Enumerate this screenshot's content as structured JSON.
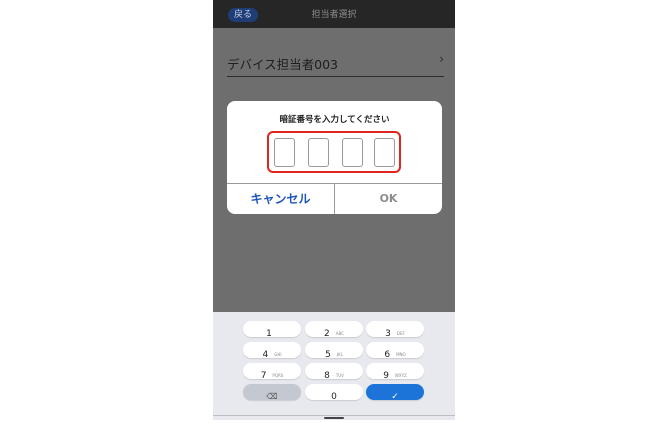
{
  "header": {
    "back_label": "戻る",
    "title": "担当者選択"
  },
  "list": {
    "item_label": "デバイス担当者003",
    "chevron": "›"
  },
  "dialog": {
    "title": "暗証番号を入力してください",
    "pin_digits": [
      "",
      "",
      "",
      ""
    ],
    "cancel_label": "キャンセル",
    "ok_label": "OK"
  },
  "keyboard": {
    "keys": [
      {
        "num": "1",
        "sub": ""
      },
      {
        "num": "2",
        "sub": "ABC"
      },
      {
        "num": "3",
        "sub": "DEF"
      },
      {
        "num": "4",
        "sub": "GHI"
      },
      {
        "num": "5",
        "sub": "JKL"
      },
      {
        "num": "6",
        "sub": "MNO"
      },
      {
        "num": "7",
        "sub": "PQRS"
      },
      {
        "num": "8",
        "sub": "TUV"
      },
      {
        "num": "9",
        "sub": "WXYZ"
      },
      {
        "num": "0",
        "sub": ""
      }
    ],
    "backspace_icon": "⌫",
    "done_icon": "✓"
  },
  "colors": {
    "accent": "#1c57b8",
    "highlight_frame": "#e0251e",
    "done_key": "#1d74d8"
  }
}
